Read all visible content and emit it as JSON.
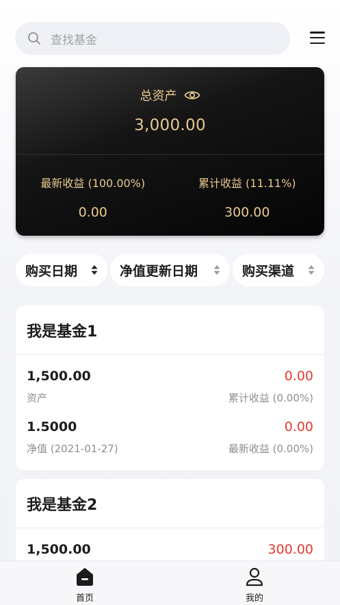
{
  "search": {
    "placeholder": "查找基金"
  },
  "icons": {
    "search": "search-icon",
    "menu": "menu-icon",
    "eye": "eye-icon",
    "sort": "sort-icon",
    "home": "home-icon",
    "profile": "profile-icon"
  },
  "summary": {
    "total_label": "总资产",
    "total_value": "3,000.00",
    "latest_label": "最新收益 (100.00%)",
    "latest_value": "0.00",
    "cumulative_label": "累计收益 (11.11%)",
    "cumulative_value": "300.00"
  },
  "filters": [
    {
      "label": "购买日期"
    },
    {
      "label": "净值更新日期"
    },
    {
      "label": "购买渠道"
    }
  ],
  "funds": [
    {
      "name": "我是基金1",
      "asset_value": "1,500.00",
      "asset_label": "资产",
      "cumulative_value": "0.00",
      "cumulative_label": "累计收益 (0.00%)",
      "nav_value": "1.5000",
      "nav_label": "净值 (2021-01-27)",
      "latest_value": "0.00",
      "latest_label": "最新收益 (0.00%)"
    },
    {
      "name": "我是基金2",
      "asset_value": "1,500.00",
      "cumulative_value": "300.00"
    }
  ],
  "tabbar": {
    "home_label": "首页",
    "mine_label": "我的"
  },
  "colors": {
    "gold": "#e9c98f",
    "red": "#e03a32",
    "gray_text": "#8e8e93",
    "background": "#f2f3f7"
  }
}
